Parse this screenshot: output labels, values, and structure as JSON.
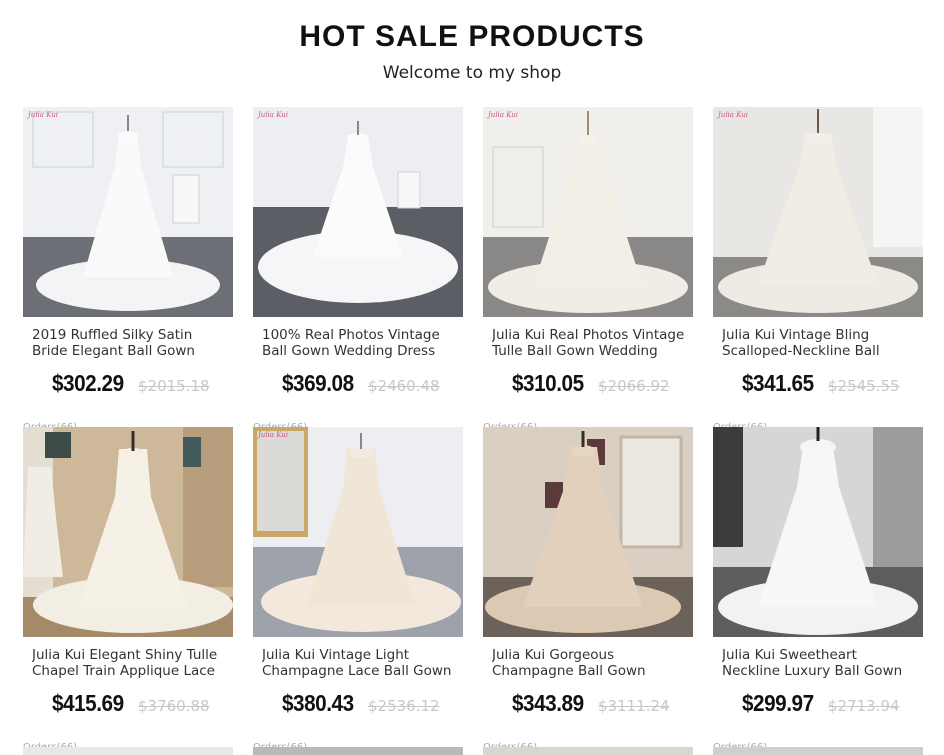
{
  "header": {
    "title": "HOT SALE PRODUCTS",
    "subtitle": "Welcome to my shop"
  },
  "brand_watermark": "Julia Kui",
  "colors": {
    "watermark": "#c8578a",
    "old_price": "#c8c8c8"
  },
  "products": [
    {
      "name": "2019 Ruffled Silky Satin\nBride Elegant Ball Gown",
      "price": "$302.29",
      "old_price": "$2015.18",
      "orders": "Orders(66)"
    },
    {
      "name": "100% Real Photos Vintage\nBall Gown Wedding Dress",
      "price": "$369.08",
      "old_price": "$2460.48",
      "orders": "Orders(66)"
    },
    {
      "name": "Julia Kui Real Photos Vintage\nTulle Ball Gown Wedding",
      "price": "$310.05",
      "old_price": "$2066.92",
      "orders": "Orders(66)"
    },
    {
      "name": "Julia Kui Vintage Bling\nScalloped-Neckline Ball",
      "price": "$341.65",
      "old_price": "$2545.55",
      "orders": "Orders(66)"
    },
    {
      "name": "Julia Kui Elegant Shiny Tulle\nChapel Train Applique Lace",
      "price": "$415.69",
      "old_price": "$3760.88",
      "orders": "Orders(66)"
    },
    {
      "name": "Julia Kui Vintage Light\nChampagne Lace Ball Gown",
      "price": "$380.43",
      "old_price": "$2536.12",
      "orders": "Orders(66)"
    },
    {
      "name": "Julia Kui Gorgeous\nChampagne Ball Gown",
      "price": "$343.89",
      "old_price": "$3111.24",
      "orders": "Orders(66)"
    },
    {
      "name": "Julia Kui Sweetheart\nNeckline Luxury Ball Gown",
      "price": "$299.97",
      "old_price": "$2713.94",
      "orders": "Orders(66)"
    }
  ]
}
